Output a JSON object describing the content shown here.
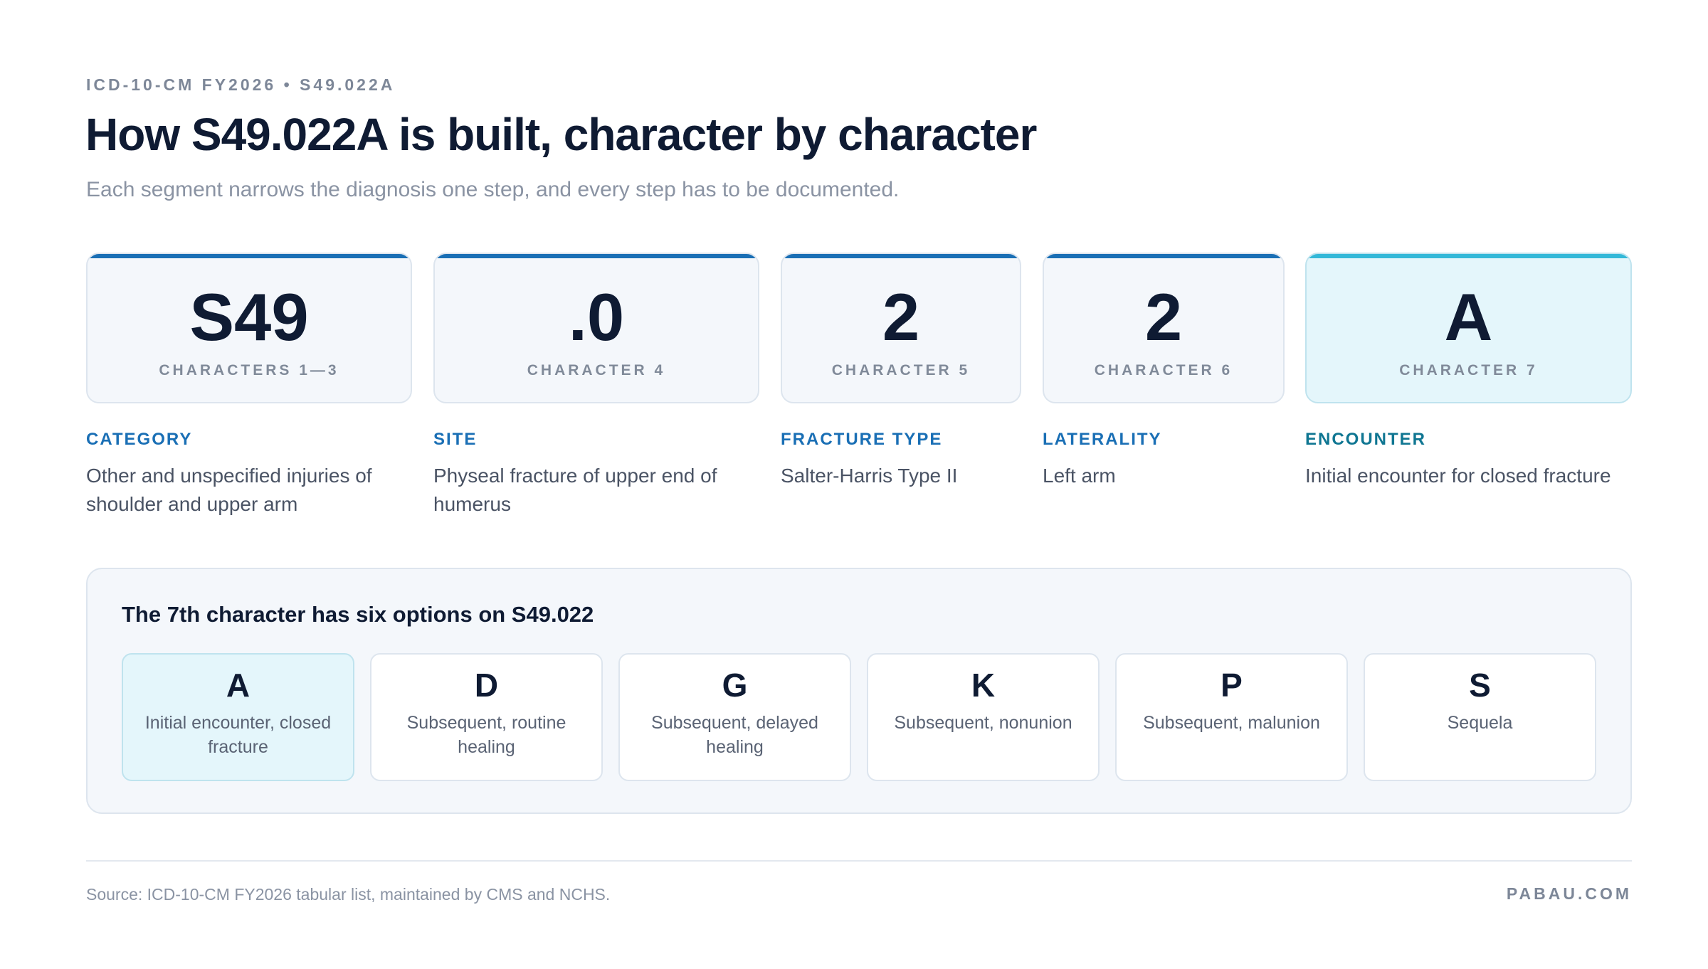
{
  "header": {
    "eyebrow": "ICD-10-CM FY2026 • S49.022A",
    "title": "How S49.022A is built, character by character",
    "subtitle": "Each segment narrows the diagnosis one step, and every step has to be documented."
  },
  "segments": [
    {
      "code": "S49",
      "characters": "CHARACTERS 1—3",
      "label": "CATEGORY",
      "description": "Other and unspecified injuries of shoulder and upper arm",
      "highlight": false
    },
    {
      "code": ".0",
      "characters": "CHARACTER 4",
      "label": "SITE",
      "description": "Physeal fracture of upper end of humerus",
      "highlight": false
    },
    {
      "code": "2",
      "characters": "CHARACTER 5",
      "label": "FRACTURE TYPE",
      "description": "Salter-Harris Type II",
      "highlight": false
    },
    {
      "code": "2",
      "characters": "CHARACTER 6",
      "label": "LATERALITY",
      "description": "Left arm",
      "highlight": false
    },
    {
      "code": "A",
      "characters": "CHARACTER 7",
      "label": "ENCOUNTER",
      "description": "Initial encounter for closed fracture",
      "highlight": true
    }
  ],
  "options_panel": {
    "title": "The 7th character has six options on S49.022",
    "options": [
      {
        "letter": "A",
        "description": "Initial encounter, closed fracture",
        "selected": true
      },
      {
        "letter": "D",
        "description": "Subsequent, routine healing",
        "selected": false
      },
      {
        "letter": "G",
        "description": "Subsequent, delayed healing",
        "selected": false
      },
      {
        "letter": "K",
        "description": "Subsequent, nonunion",
        "selected": false
      },
      {
        "letter": "P",
        "description": "Subsequent, malunion",
        "selected": false
      },
      {
        "letter": "S",
        "description": "Sequela",
        "selected": false
      }
    ]
  },
  "footer": {
    "source": "Source: ICD-10-CM FY2026 tabular list, maintained by CMS and NCHS.",
    "brand": "PABAU.COM"
  },
  "colors": {
    "accent_blue": "#1a6fb5",
    "accent_teal": "#33b8d8",
    "highlight_bg": "#e4f6fb",
    "ink": "#0f1b33"
  }
}
